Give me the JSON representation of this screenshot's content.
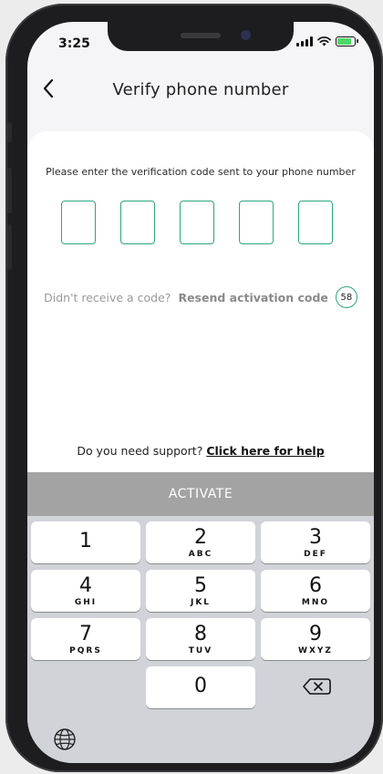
{
  "status_bar": {
    "time": "3:25"
  },
  "header": {
    "back_icon": "chevron-left-icon",
    "title": "Verify phone number"
  },
  "verify": {
    "instruction": "Please enter the verification code sent to your phone number",
    "code_digits": [
      "",
      "",
      "",
      "",
      ""
    ],
    "resend_question": "Didn't receive a code?",
    "resend_link": "Resend activation code",
    "countdown": "58"
  },
  "support": {
    "question": "Do you need support?",
    "link": "Click here for help"
  },
  "activate_button": {
    "label": "ACTIVATE"
  },
  "keypad": {
    "keys": [
      {
        "num": "1",
        "letters": ""
      },
      {
        "num": "2",
        "letters": "ABC"
      },
      {
        "num": "3",
        "letters": "DEF"
      },
      {
        "num": "4",
        "letters": "GHI"
      },
      {
        "num": "5",
        "letters": "JKL"
      },
      {
        "num": "6",
        "letters": "MNO"
      },
      {
        "num": "7",
        "letters": "PQRS"
      },
      {
        "num": "8",
        "letters": "TUV"
      },
      {
        "num": "9",
        "letters": "WXYZ"
      },
      {
        "num": "0",
        "letters": ""
      }
    ],
    "delete_icon": "backspace-icon",
    "globe_icon": "globe-icon"
  },
  "colors": {
    "accent": "#2ea582",
    "button_disabled": "#a3a3a3",
    "keyboard_bg": "#d1d3d9"
  }
}
